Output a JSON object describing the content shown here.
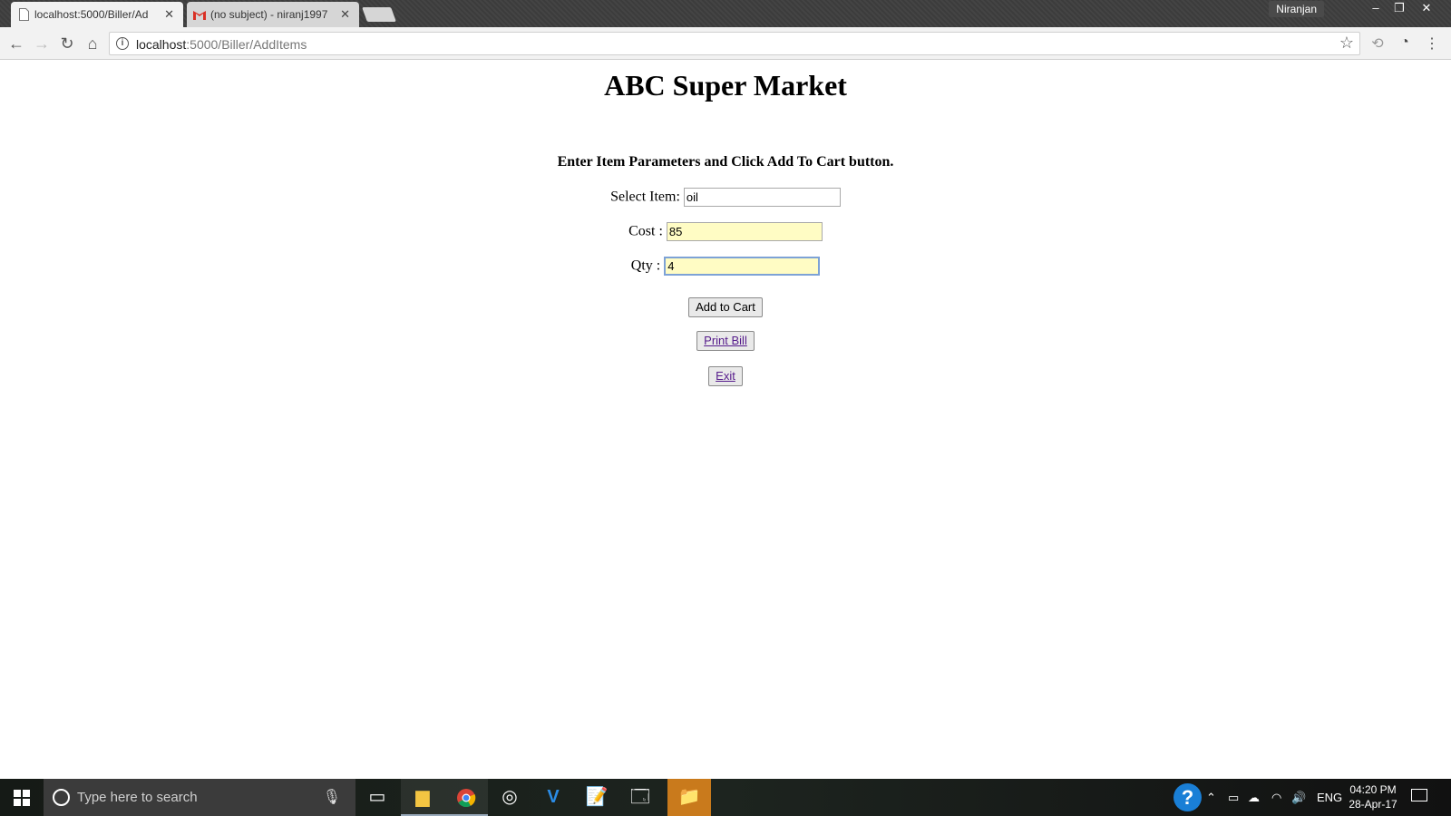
{
  "browser": {
    "tabs": [
      {
        "title": "localhost:5000/Biller/Ad",
        "active": true
      },
      {
        "title": "(no subject) - niranj1997",
        "active": false
      }
    ],
    "profile_name": "Niranjan",
    "url_host": "localhost",
    "url_path": ":5000/Biller/AddItems"
  },
  "page": {
    "title": "ABC Super Market",
    "instructions": "Enter Item Parameters and Click Add To Cart button.",
    "fields": {
      "item_label": "Select Item:",
      "item_value": "oil",
      "cost_label": "Cost :",
      "cost_value": "85",
      "qty_label": "Qty :",
      "qty_value": "4"
    },
    "buttons": {
      "add_to_cart": "Add to Cart",
      "print_bill": "Print Bill",
      "exit": "Exit"
    }
  },
  "taskbar": {
    "search_placeholder": "Type here to search",
    "language": "ENG",
    "time": "04:20 PM",
    "date": "28-Apr-17"
  },
  "colors": {
    "autofill_background": "#fffcc4",
    "focus_border": "#7da2d6",
    "link_color": "#551a8b"
  }
}
